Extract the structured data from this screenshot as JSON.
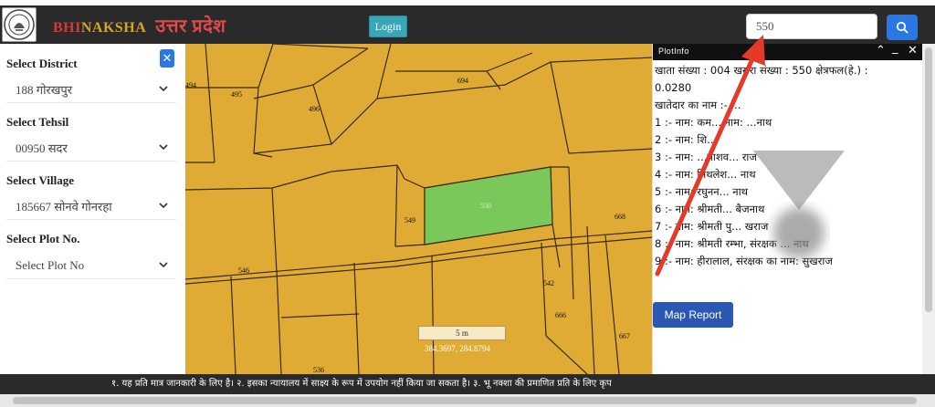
{
  "header": {
    "brand_bhi": "BHI",
    "brand_naksha": "NAKSHA",
    "brand_state": "उत्तर प्रदेश",
    "login_label": "Login",
    "search_value": "550"
  },
  "sidebar": {
    "fields": [
      {
        "label": "Select District",
        "value": "188 गोरखपुर"
      },
      {
        "label": "Select Tehsil",
        "value": "00950 सदर"
      },
      {
        "label": "Select Village",
        "value": "185667 सोनवे गोनरहा"
      },
      {
        "label": "Select Plot No.",
        "value": "Select Plot No"
      }
    ]
  },
  "map": {
    "plot_labels": [
      "495",
      "496",
      "694",
      "494",
      "549",
      "550",
      "546",
      "542",
      "666",
      "668",
      "667",
      "536"
    ],
    "scale": "5 m",
    "coordinates": "384.3697, 284.8794",
    "colors": {
      "land": "#e0ab35",
      "selected": "#7bc85a",
      "lines": "#3a2a10"
    }
  },
  "plotinfo": {
    "title": "PlotInfo",
    "lines": [
      "खाता संख्या : 004 खसरा संख्या : 550 क्षेत्रफल(हे.) :",
      "0.0280",
      "खातेदार का नाम :- ...",
      "1 :- नाम: कम... नाम: ...नाथ",
      "2 :- नाम: शि...",
      "3 :- नाम: ...पाशव... राज",
      "4 :- नाम: मिथलेश... नाथ",
      "5 :- नाम: रघुनन... नाथ",
      "6 :- नाम: श्रीमती... बैजनाथ",
      "7 :- नाम: श्रीमती पु... खराज",
      "8 :- नाम: श्रीमती रम्भा, संरक्षक ... नाथ",
      "9 :- नाम: हीरालाल, संरक्षक का नाम: सुखराज"
    ],
    "map_report_label": "Map Report"
  },
  "ticker": {
    "text": "१. यह प्रति मात्र जानकारी के लिए है। २. इसका न्यायालय में साक्ष्य के रूप में उपयोग नहीं किया जा सकता है। ३. भू नक्शा की प्रमाणित प्रति के लिए कृप"
  }
}
